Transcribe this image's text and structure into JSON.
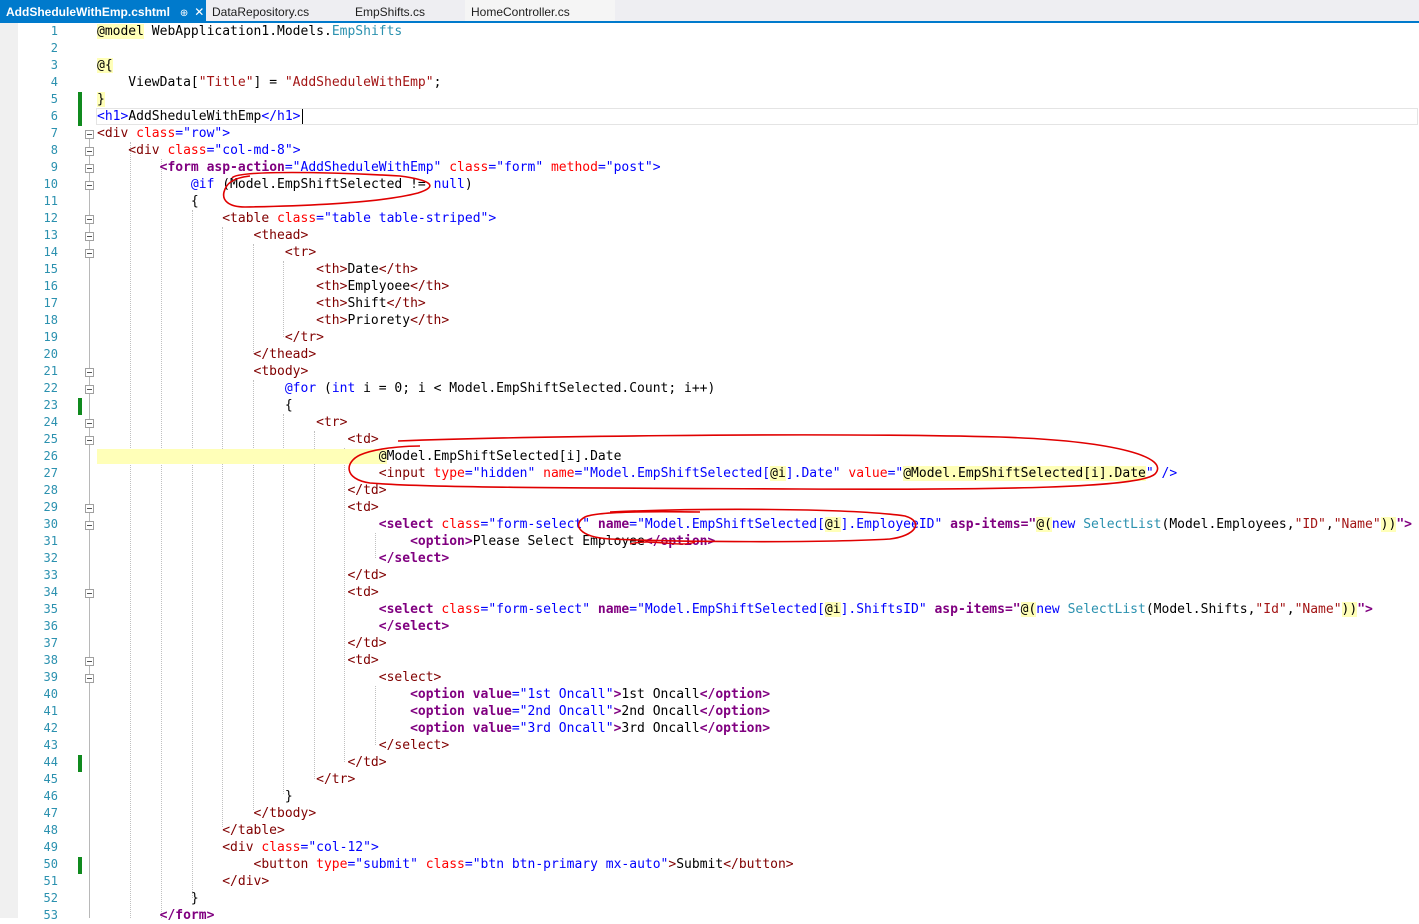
{
  "tabs": [
    {
      "label": "AddSheduleWithEmp.cshtml",
      "pin": "⊕",
      "close": "✕"
    },
    {
      "label": "DataRepository.cs"
    },
    {
      "label": "EmpShifts.cs"
    },
    {
      "label": "HomeController.cs"
    }
  ],
  "lines": [
    "1",
    "2",
    "3",
    "4",
    "5",
    "6",
    "7",
    "8",
    "9",
    "10",
    "11",
    "12",
    "13",
    "14",
    "15",
    "16",
    "17",
    "18",
    "19",
    "20",
    "21",
    "22",
    "23",
    "24",
    "25",
    "26",
    "27",
    "28",
    "29",
    "30",
    "31",
    "32",
    "33",
    "34",
    "35",
    "36",
    "37",
    "38",
    "39",
    "40",
    "41",
    "42",
    "43",
    "44",
    "45",
    "46",
    "47",
    "48",
    "49",
    "50",
    "51",
    "52",
    "53"
  ],
  "code": {
    "l1": {
      "a": "@model",
      "b": " WebApplication1.Models.",
      "c": "EmpShifts"
    },
    "l3": {
      "a": "@{"
    },
    "l4": {
      "a": "    ViewData[",
      "b": "\"Title\"",
      "c": "] = ",
      "d": "\"AddSheduleWithEmp\"",
      "e": ";"
    },
    "l5": {
      "a": "}"
    },
    "l6": {
      "a": "<h1>",
      "b": "AddSheduleWithEmp",
      "c": "</h1>",
      "d": " "
    },
    "l7": {
      "a": "<div",
      "b": " class",
      "c": "=",
      "d": "\"row\"",
      "e": ">"
    },
    "l8": {
      "a": "    <div",
      "b": " class",
      "c": "=",
      "d": "\"col-md-8\"",
      "e": ">"
    },
    "l9": {
      "a": "        <form",
      "b": " asp-action",
      "c": "=",
      "d": "\"AddSheduleWithEmp\"",
      "e": " class",
      "f": "=",
      "g": "\"form\"",
      "h": " method",
      "i": "=",
      "j": "\"post\"",
      "k": ">"
    },
    "l10": {
      "a": "            @if",
      "b": " (Model.EmpShiftSelected != ",
      "c": "null",
      "d": ")"
    },
    "l11": {
      "a": "            {"
    },
    "l12": {
      "a": "                <table",
      "b": " class",
      "c": "=",
      "d": "\"table table-striped\"",
      "e": ">"
    },
    "l13": {
      "a": "                    <thead>"
    },
    "l14": {
      "a": "                        <tr>"
    },
    "l15": {
      "a": "                            <th>",
      "b": "Date",
      "c": "</th>"
    },
    "l16": {
      "a": "                            <th>",
      "b": "Emplyoee",
      "c": "</th>"
    },
    "l17": {
      "a": "                            <th>",
      "b": "Shift",
      "c": "</th>"
    },
    "l18": {
      "a": "                            <th>",
      "b": "Priorety",
      "c": "</th>"
    },
    "l19": {
      "a": "                        </tr>"
    },
    "l20": {
      "a": "                    </thead>"
    },
    "l21": {
      "a": "                    <tbody>"
    },
    "l22": {
      "a": "                        @for",
      "b": " (",
      "c": "int",
      "d": " i = 0; i < Model.EmpShiftSelected.Count; i++)"
    },
    "l23": {
      "a": "                        {"
    },
    "l24": {
      "a": "                            <tr>"
    },
    "l25": {
      "a": "                                <td>"
    },
    "l26": {
      "a": "                                    @",
      "b": "Model.EmpShiftSelected[i].Date"
    },
    "l27": {
      "a": "                                    <input",
      "b": " type",
      "c": "=",
      "d": "\"hidden\"",
      "e": " name",
      "f": "=",
      "g": "\"Model.EmpShiftSelected[",
      "h": "@i",
      "i": "].Date\"",
      "j": " value",
      "k": "=",
      "l": "\"",
      "m": "@Model.EmpShiftSelected[i].Date",
      "n": "\"",
      "o": " />"
    },
    "l28": {
      "a": "                                </td>"
    },
    "l29": {
      "a": "                                <td>"
    },
    "l30": {
      "a": "                                    <select",
      "b": " class",
      "c": "=",
      "d": "\"form-select\"",
      "e": " name",
      "f": "=",
      "g": "\"Model.EmpShiftSelected[",
      "h": "@i",
      "i": "].EmployeeID\"",
      "j": " asp-items",
      "k": "=",
      "l": "\"",
      "m": "@(",
      "n": "new",
      "o": " ",
      "p": "SelectList",
      "q": "(Model.Employees,",
      "r": "\"ID\"",
      "s": ",",
      "t": "\"Name\"",
      "u": "))",
      "v": "\">"
    },
    "l31": {
      "a": "                                        <option>",
      "b": "Please Select Employee",
      "c": "</option>"
    },
    "l32": {
      "a": "                                    </select>"
    },
    "l33": {
      "a": "                                </td>"
    },
    "l34": {
      "a": "                                <td>"
    },
    "l35": {
      "a": "                                    <select",
      "b": " class",
      "c": "=",
      "d": "\"form-select\"",
      "e": " name",
      "f": "=",
      "g": "\"Model.EmpShiftSelected[",
      "h": "@i",
      "i": "].ShiftsID\"",
      "j": " asp-items",
      "k": "=",
      "l": "\"",
      "m": "@(",
      "n": "new",
      "o": " ",
      "p": "SelectList",
      "q": "(Model.Shifts,",
      "r": "\"Id\"",
      "s": ",",
      "t": "\"Name\"",
      "u": "))",
      "v": "\">"
    },
    "l36": {
      "a": "                                    </select>"
    },
    "l37": {
      "a": "                                </td>"
    },
    "l38": {
      "a": "                                <td>"
    },
    "l39": {
      "a": "                                    <select>"
    },
    "l40": {
      "a": "                                        <option",
      "b": " value",
      "c": "=",
      "d": "\"1st Oncall\"",
      "e": ">",
      "f": "1st Oncall",
      "g": "</option>"
    },
    "l41": {
      "a": "                                        <option",
      "b": " value",
      "c": "=",
      "d": "\"2nd Oncall\"",
      "e": ">",
      "f": "2nd Oncall",
      "g": "</option>"
    },
    "l42": {
      "a": "                                        <option",
      "b": " value",
      "c": "=",
      "d": "\"3rd Oncall\"",
      "e": ">",
      "f": "3rd Oncall",
      "g": "</option>"
    },
    "l43": {
      "a": "                                    </select>"
    },
    "l44": {
      "a": "                                </td>"
    },
    "l45": {
      "a": "                            </tr>"
    },
    "l46": {
      "a": "                        }"
    },
    "l47": {
      "a": "                    </tbody>"
    },
    "l48": {
      "a": "                </table>"
    },
    "l49": {
      "a": "                <div",
      "b": " class",
      "c": "=",
      "d": "\"col-12\"",
      "e": ">"
    },
    "l50": {
      "a": "                    <button",
      "b": " type",
      "c": "=",
      "d": "\"submit\"",
      "e": " class",
      "f": "=",
      "g": "\"btn btn-primary mx-auto\"",
      "h": ">",
      "i": "Submit",
      "j": "</button>"
    },
    "l51": {
      "a": "                </div>"
    },
    "l52": {
      "a": "            }"
    },
    "l53": {
      "a": "        </form>"
    }
  },
  "colors": {
    "accent": "#007acc",
    "annotation": "#e00000",
    "line_number": "#2b91af",
    "changed_marker": "#108a1e"
  }
}
